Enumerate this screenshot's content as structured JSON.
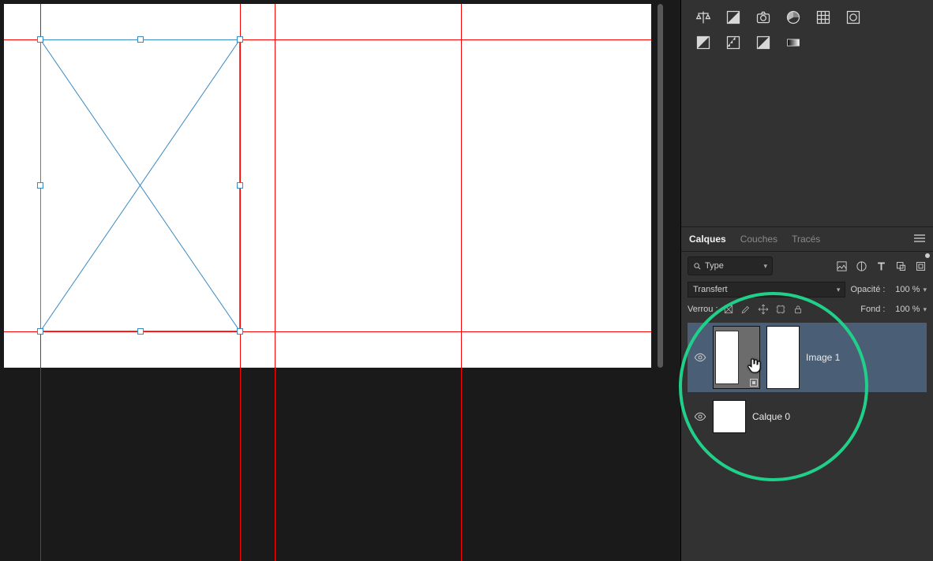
{
  "panels": {
    "tabs": {
      "layers": "Calques",
      "channels": "Couches",
      "paths": "Tracés"
    },
    "filter": {
      "type_label": "Type"
    },
    "blend": {
      "mode": "Transfert",
      "opacity_label": "Opacité :",
      "opacity_value": "100 %"
    },
    "lock": {
      "label": "Verrou :",
      "fill_label": "Fond :",
      "fill_value": "100 %"
    }
  },
  "layers": [
    {
      "name": "Image 1",
      "selected": true,
      "smart_object": true,
      "visible": true
    },
    {
      "name": "Calque 0",
      "selected": false,
      "smart_object": false,
      "visible": true
    }
  ]
}
